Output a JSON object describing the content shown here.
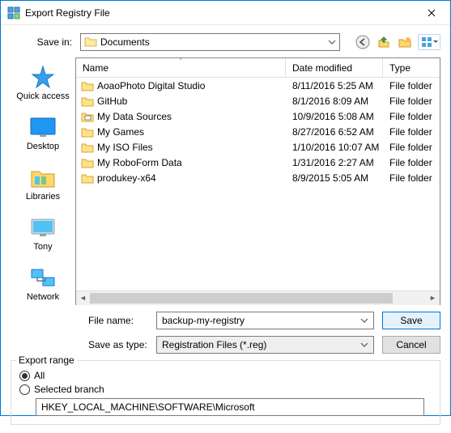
{
  "window": {
    "title": "Export Registry File"
  },
  "savein": {
    "label": "Save in:",
    "value": "Documents"
  },
  "columns": {
    "name": "Name",
    "date": "Date modified",
    "type": "Type"
  },
  "places": [
    {
      "label": "Quick access"
    },
    {
      "label": "Desktop"
    },
    {
      "label": "Libraries"
    },
    {
      "label": "Tony"
    },
    {
      "label": "Network"
    }
  ],
  "files": [
    {
      "name": "AoaoPhoto Digital Studio",
      "date": "8/11/2016 5:25 AM",
      "type": "File folder",
      "special": false
    },
    {
      "name": "GitHub",
      "date": "8/1/2016 8:09 AM",
      "type": "File folder",
      "special": false
    },
    {
      "name": "My Data Sources",
      "date": "10/9/2016 5:08 AM",
      "type": "File folder",
      "special": true
    },
    {
      "name": "My Games",
      "date": "8/27/2016 6:52 AM",
      "type": "File folder",
      "special": false
    },
    {
      "name": "My ISO Files",
      "date": "1/10/2016 10:07 AM",
      "type": "File folder",
      "special": false
    },
    {
      "name": "My RoboForm Data",
      "date": "1/31/2016 2:27 AM",
      "type": "File folder",
      "special": false
    },
    {
      "name": "produkey-x64",
      "date": "8/9/2015 5:05 AM",
      "type": "File folder",
      "special": false
    }
  ],
  "filename": {
    "label": "File name:",
    "value": "backup-my-registry"
  },
  "savetype": {
    "label": "Save as type:",
    "value": "Registration Files (*.reg)"
  },
  "buttons": {
    "save": "Save",
    "cancel": "Cancel"
  },
  "export": {
    "legend": "Export range",
    "all": "All",
    "selected": "Selected branch",
    "branch": "HKEY_LOCAL_MACHINE\\SOFTWARE\\Microsoft"
  }
}
